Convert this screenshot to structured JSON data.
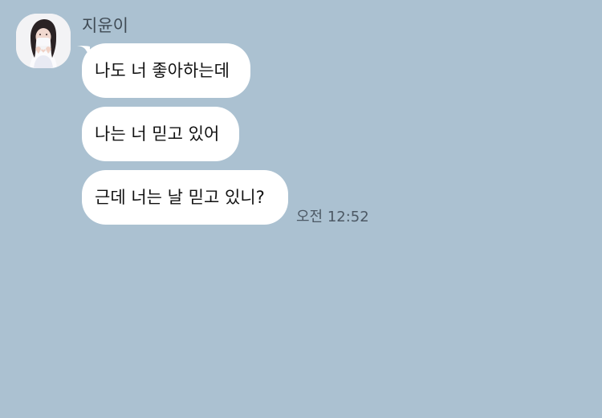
{
  "chat": {
    "sender": "지윤이",
    "messages": [
      {
        "text": "나도 너 좋아하는데"
      },
      {
        "text": "나는 너 믿고 있어"
      },
      {
        "text": "근데 너는 날 믿고 있니?"
      }
    ],
    "timestamp": "오전 12:52"
  },
  "colors": {
    "background": "#abc1d1",
    "bubble": "#ffffff",
    "name": "#404b55",
    "timestamp": "#4c5864"
  },
  "icons": {
    "avatar": "profile-photo-avatar"
  }
}
